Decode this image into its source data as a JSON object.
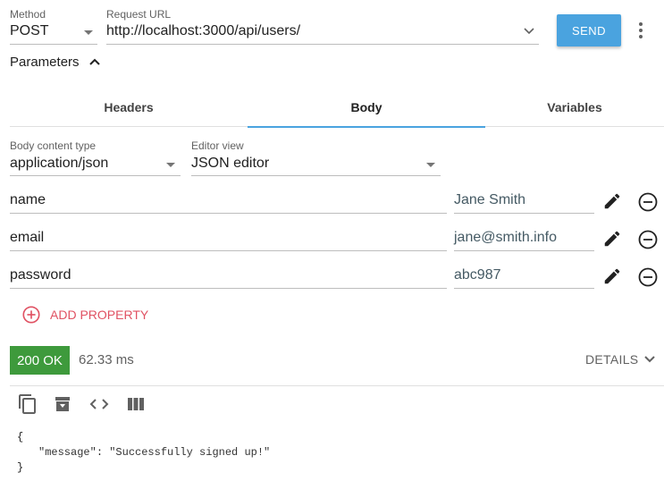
{
  "request": {
    "method_label": "Method",
    "method_value": "POST",
    "url_label": "Request URL",
    "url_value": "http://localhost:3000/api/users/",
    "send_label": "SEND"
  },
  "parameters": {
    "toggle_label": "Parameters"
  },
  "tabs": [
    {
      "label": "Headers"
    },
    {
      "label": "Body"
    },
    {
      "label": "Variables"
    }
  ],
  "body": {
    "content_type_label": "Body content type",
    "content_type_value": "application/json",
    "editor_view_label": "Editor view",
    "editor_view_value": "JSON editor",
    "properties": [
      {
        "name": "name",
        "value": "Jane Smith"
      },
      {
        "name": "email",
        "value": "jane@smith.info"
      },
      {
        "name": "password",
        "value": "abc987"
      }
    ],
    "add_property_label": "ADD PROPERTY"
  },
  "response": {
    "status": "200 OK",
    "time": "62.33 ms",
    "details_label": "DETAILS",
    "code_open": "{",
    "code_key": "\"message\"",
    "code_value": "\"Successfully signed up!\"",
    "code_close": "}"
  },
  "colors": {
    "accent": "#4aa3df",
    "status_ok": "#3e9a3c",
    "add_property": "#e05263"
  },
  "icons": [
    "chevron-down-icon",
    "more-vert-icon",
    "chevron-up-icon",
    "pencil-icon",
    "remove-circle-icon",
    "add-circle-icon",
    "copy-icon",
    "archive-icon",
    "code-icon",
    "columns-icon"
  ]
}
